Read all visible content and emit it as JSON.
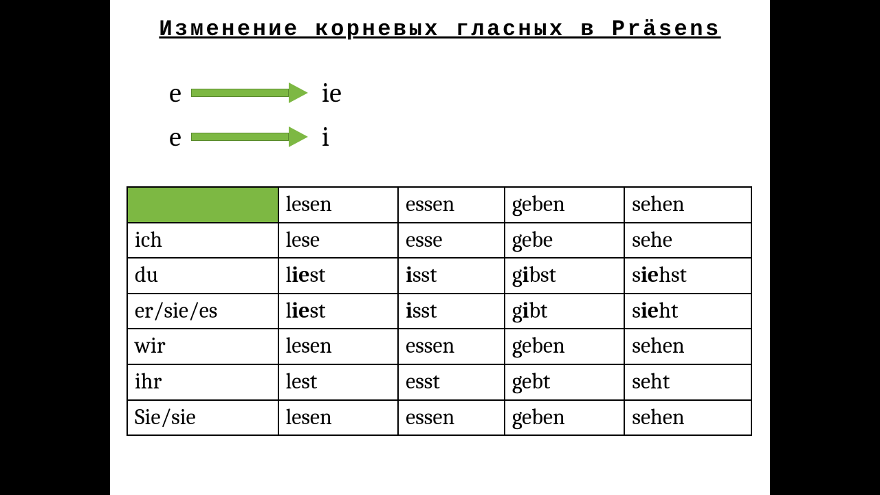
{
  "title": "Изменение корневых гласных в Präsens",
  "rules": [
    {
      "from": "e",
      "to": "ie"
    },
    {
      "from": "e",
      "to": "i"
    }
  ],
  "table": {
    "header": [
      "",
      "lesen",
      "essen",
      "geben",
      "sehen"
    ],
    "rows": [
      {
        "pronoun": "ich",
        "cells": [
          [
            {
              "t": "lese",
              "b": false
            }
          ],
          [
            {
              "t": "esse",
              "b": false
            }
          ],
          [
            {
              "t": "gebe",
              "b": false
            }
          ],
          [
            {
              "t": "sehe",
              "b": false
            }
          ]
        ]
      },
      {
        "pronoun": "du",
        "cells": [
          [
            {
              "t": "l",
              "b": false
            },
            {
              "t": "ie",
              "b": true
            },
            {
              "t": "st",
              "b": false
            }
          ],
          [
            {
              "t": "i",
              "b": true
            },
            {
              "t": "sst",
              "b": false
            }
          ],
          [
            {
              "t": "g",
              "b": false
            },
            {
              "t": "i",
              "b": true
            },
            {
              "t": "bst",
              "b": false
            }
          ],
          [
            {
              "t": "s",
              "b": false
            },
            {
              "t": "ie",
              "b": true
            },
            {
              "t": "hst",
              "b": false
            }
          ]
        ]
      },
      {
        "pronoun": "er/sie/es",
        "cells": [
          [
            {
              "t": "l",
              "b": false
            },
            {
              "t": "ie",
              "b": true
            },
            {
              "t": "st",
              "b": false
            }
          ],
          [
            {
              "t": "i",
              "b": true
            },
            {
              "t": "sst",
              "b": false
            }
          ],
          [
            {
              "t": "g",
              "b": false
            },
            {
              "t": "i",
              "b": true
            },
            {
              "t": "bt",
              "b": false
            }
          ],
          [
            {
              "t": "s",
              "b": false
            },
            {
              "t": "ie",
              "b": true
            },
            {
              "t": "ht",
              "b": false
            }
          ]
        ]
      },
      {
        "pronoun": "wir",
        "cells": [
          [
            {
              "t": "lesen",
              "b": false
            }
          ],
          [
            {
              "t": "essen",
              "b": false
            }
          ],
          [
            {
              "t": "geben",
              "b": false
            }
          ],
          [
            {
              "t": "sehen",
              "b": false
            }
          ]
        ]
      },
      {
        "pronoun": "ihr",
        "cells": [
          [
            {
              "t": "lest",
              "b": false
            }
          ],
          [
            {
              "t": "esst",
              "b": false
            }
          ],
          [
            {
              "t": "gebt",
              "b": false
            }
          ],
          [
            {
              "t": "seht",
              "b": false
            }
          ]
        ]
      },
      {
        "pronoun": "Sie/sie",
        "cells": [
          [
            {
              "t": "lesen",
              "b": false
            }
          ],
          [
            {
              "t": "essen",
              "b": false
            }
          ],
          [
            {
              "t": "geben",
              "b": false
            }
          ],
          [
            {
              "t": "sehen",
              "b": false
            }
          ]
        ]
      }
    ]
  },
  "colors": {
    "accent_green": "#7db843"
  }
}
